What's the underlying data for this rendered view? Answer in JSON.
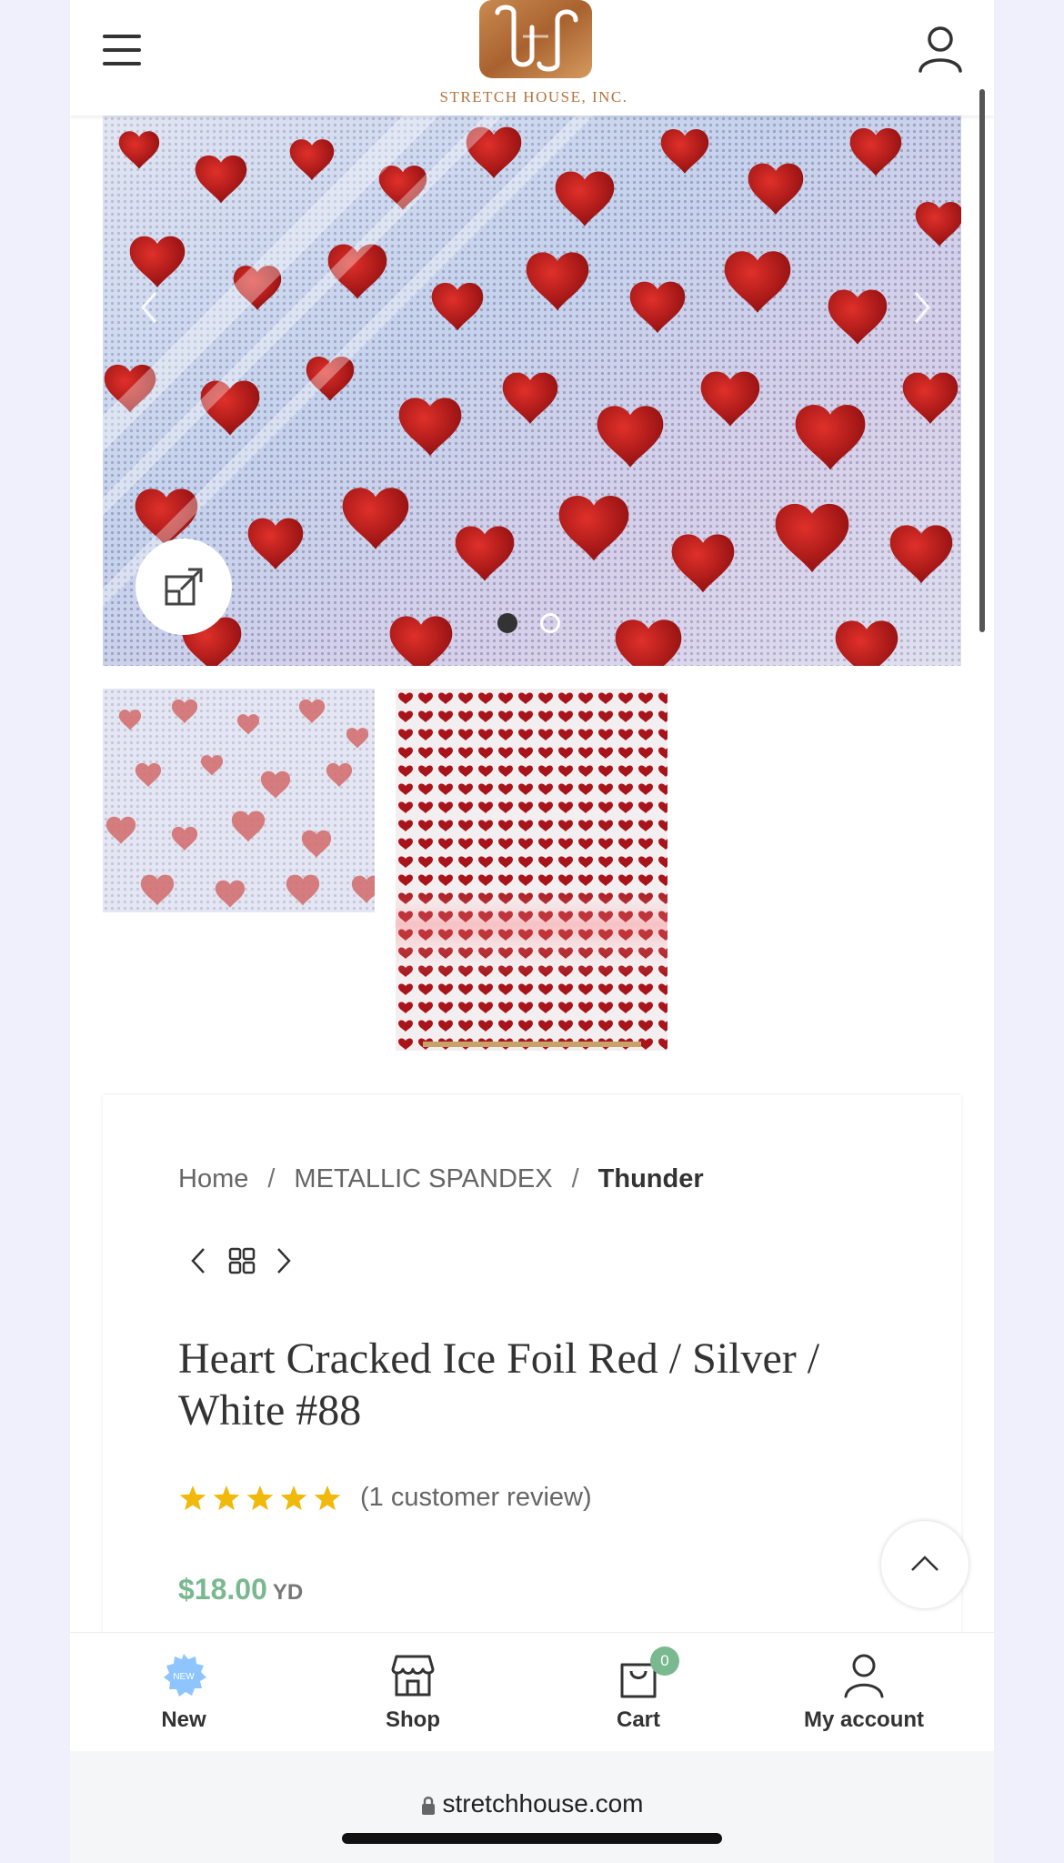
{
  "header": {
    "menu_icon": "hamburger-menu-icon",
    "logo_text": "STRETCH HOUSE, INC.",
    "account_icon": "user-icon"
  },
  "gallery": {
    "prev_icon": "chevron-left-icon",
    "next_icon": "chevron-right-icon",
    "zoom_icon": "expand-icon",
    "slide_count": 2,
    "active_slide": 1
  },
  "breadcrumb": {
    "home": "Home",
    "sep1": "/",
    "category": "METALLIC SPANDEX",
    "sep2": "/",
    "current": "Thunder"
  },
  "product": {
    "title": "Heart Cracked Ice Foil Red / Silver / White #88",
    "rating": 5,
    "rating_max": 5,
    "reviews": "(1 customer review)",
    "price": "$18.00",
    "unit": "YD"
  },
  "toolbar": {
    "items": [
      {
        "label": "New",
        "icon": "new-badge-icon",
        "badge_text": "NEW"
      },
      {
        "label": "Shop",
        "icon": "store-icon"
      },
      {
        "label": "Cart",
        "icon": "shopping-bag-icon",
        "count": "0"
      },
      {
        "label": "My account",
        "icon": "user-icon"
      }
    ]
  },
  "browser": {
    "url": "stretchhouse.com"
  },
  "colors": {
    "accent_green": "#7ab88f",
    "star_gold": "#f0b90b",
    "logo_bronze": "#b5713c",
    "background": "#eff0fb"
  }
}
